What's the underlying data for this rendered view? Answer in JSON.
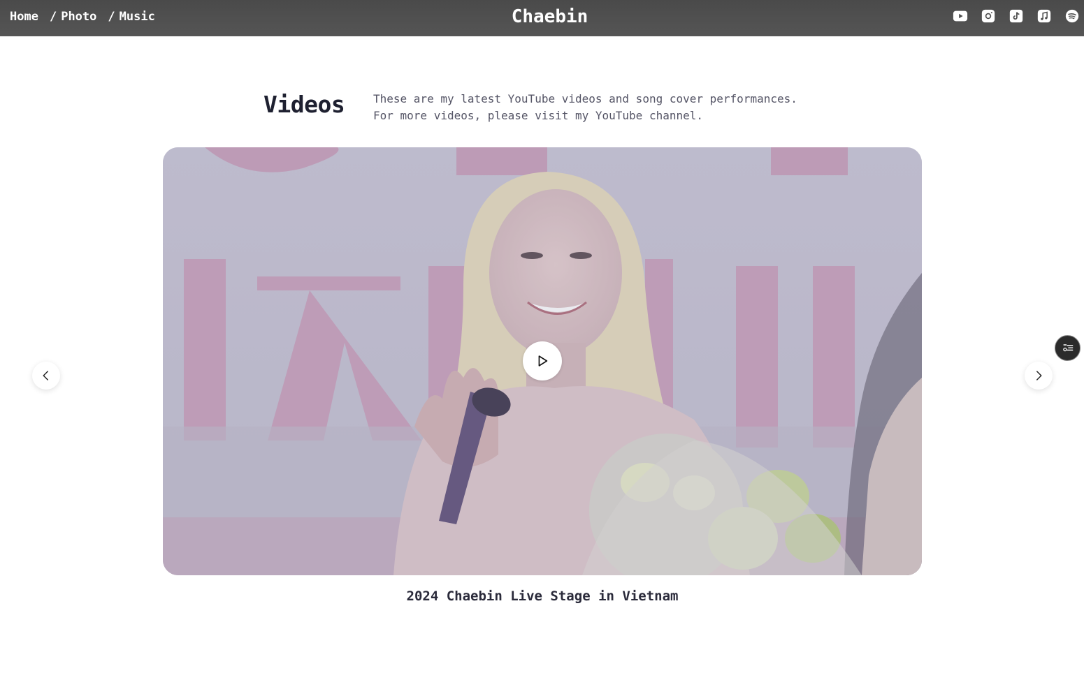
{
  "nav": {
    "home": "Home",
    "photo": "Photo",
    "music": "Music",
    "separator": "/"
  },
  "brand": "Chaebin",
  "socials": [
    {
      "icon": "youtube-icon"
    },
    {
      "icon": "instagram-icon"
    },
    {
      "icon": "tiktok-icon"
    },
    {
      "icon": "apple-music-icon"
    },
    {
      "icon": "spotify-icon"
    }
  ],
  "videos": {
    "title": "Videos",
    "description_line1": "These are my latest YouTube videos and song cover performances.",
    "description_line2": "For more videos, please visit my YouTube channel.",
    "current_caption": "2024 Chaebin Live Stage in Vietnam"
  },
  "colors": {
    "topbar": "#4f4f4f",
    "text_dark": "#1e2030",
    "text_muted": "#555566"
  }
}
